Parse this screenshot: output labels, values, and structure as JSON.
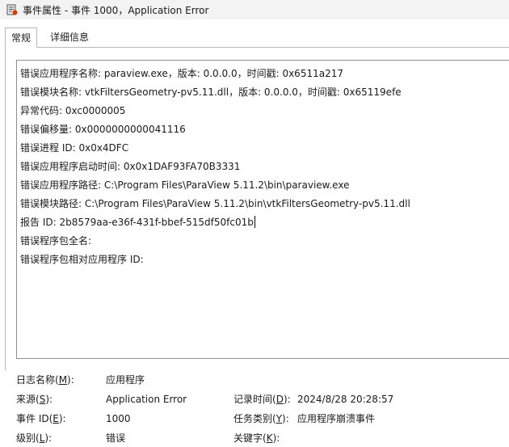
{
  "window": {
    "title": "事件属性 - 事件 1000，Application Error"
  },
  "tabs": [
    {
      "label": "常规",
      "active": true
    },
    {
      "label": "详细信息",
      "active": false
    }
  ],
  "description": {
    "lines": [
      "错误应用程序名称: paraview.exe，版本: 0.0.0.0，时间戳: 0x6511a217",
      "错误模块名称: vtkFiltersGeometry-pv5.11.dll，版本: 0.0.0.0，时间戳: 0x65119efe",
      "异常代码: 0xc0000005",
      "错误偏移量: 0x0000000000041116",
      "错误进程 ID: 0x0x4DFC",
      "错误应用程序启动时间: 0x0x1DAF93FA70B3331",
      "错误应用程序路径: C:\\Program Files\\ParaView 5.11.2\\bin\\paraview.exe",
      "错误模块路径: C:\\Program Files\\ParaView 5.11.2\\bin\\vtkFiltersGeometry-pv5.11.dll",
      "报告 ID: 2b8579aa-e36f-431f-bbef-515df50fc01b",
      "错误程序包全名:",
      "错误程序包相对应用程序 ID:"
    ]
  },
  "fields": {
    "log_name": {
      "label_pre": "日志名称(",
      "key": "M",
      "label_post": "):",
      "value": "应用程序"
    },
    "source": {
      "label_pre": "来源(",
      "key": "S",
      "label_post": "):",
      "value": "Application Error"
    },
    "logged": {
      "label_pre": "记录时间(",
      "key": "D",
      "label_post": "):",
      "value": "2024/8/28 20:28:57"
    },
    "event_id": {
      "label_pre": "事件 ID(",
      "key": "E",
      "label_post": "):",
      "value": "1000"
    },
    "task_category": {
      "label_pre": "任务类别(",
      "key": "Y",
      "label_post": "):",
      "value": "应用程序崩溃事件"
    },
    "level": {
      "label_pre": "级别(",
      "key": "L",
      "label_post": "):",
      "value": "错误"
    },
    "keywords": {
      "label_pre": "关键字(",
      "key": "K",
      "label_post": "):",
      "value": ""
    }
  },
  "colors": {
    "titlebar_bg": "#f3f3f3",
    "border": "#8e8e8e"
  }
}
